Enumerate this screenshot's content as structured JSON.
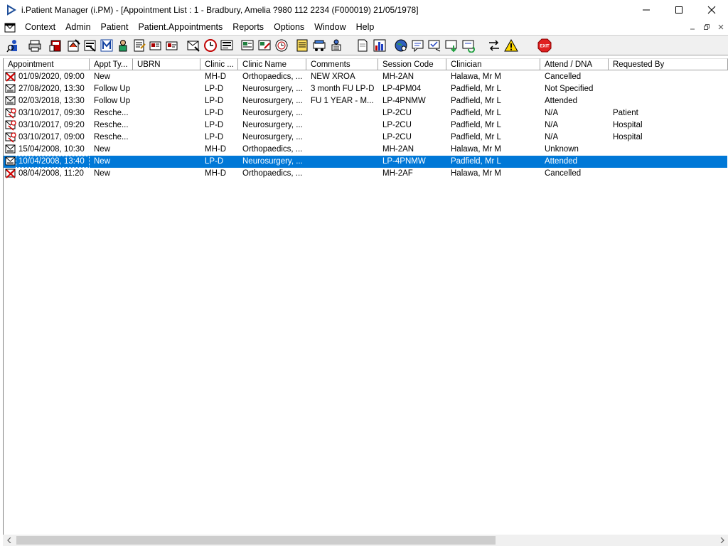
{
  "window": {
    "title": "i.Patient Manager (i.PM) - [Appointment List : 1 - Bradbury, Amelia ?980 112 2234 (F000019) 21/05/1978]",
    "minimize_icon": "minimize-icon",
    "maximize_icon": "maximize-icon",
    "close_icon": "close-icon"
  },
  "menu": {
    "items": [
      "Context",
      "Admin",
      "Patient",
      "Patient.Appointments",
      "Reports",
      "Options",
      "Window",
      "Help"
    ]
  },
  "toolbar": {
    "buttons": [
      "patient-search-icon",
      "print-icon",
      "book-appointment-icon",
      "edit-appointment-icon",
      "appointment-details-icon",
      "letter-m-icon",
      "clinician-icon",
      "notes-icon",
      "referral-icon",
      "referral-card-icon",
      "cancel-mail-icon",
      "clock-icon",
      "screen-list-icon",
      "session-icon",
      "session-edit-icon",
      "session-clock-icon",
      "note-yellow-icon",
      "transport-icon",
      "waiting-list-icon",
      "document-icon",
      "chart-icon",
      "globe-icon",
      "message-icon",
      "message-check-icon",
      "message-down-icon",
      "message-refresh-icon",
      "swap-icon",
      "warning-icon",
      "exit-icon"
    ],
    "exit_label": "EXIT"
  },
  "table": {
    "columns": [
      "Appointment",
      "Appt Ty...",
      "UBRN",
      "Clinic ...",
      "Clinic Name",
      "Comments",
      "Session Code",
      "Clinician",
      "Attend / DNA",
      "Requested By"
    ],
    "rows": [
      {
        "icon": "cancelled-appointment-icon",
        "appointment": "01/09/2020, 09:00",
        "type": "New",
        "ubrn": "",
        "clinic": "MH-D",
        "clinic_name": "Orthopaedics, ...",
        "comments": "NEW XROA",
        "session": "MH-2AN",
        "clinician": "Halawa, Mr M",
        "attend": "Cancelled",
        "requested": ""
      },
      {
        "icon": "appointment-envelope-icon",
        "appointment": "27/08/2020, 13:30",
        "type": "Follow Up",
        "ubrn": "",
        "clinic": "LP-D",
        "clinic_name": "Neurosurgery, ...",
        "comments": "3 month FU LP-D",
        "session": "LP-4PM04",
        "clinician": "Padfield, Mr L",
        "attend": "Not Specified",
        "requested": ""
      },
      {
        "icon": "appointment-envelope-icon",
        "appointment": "02/03/2018, 13:30",
        "type": "Follow Up",
        "ubrn": "",
        "clinic": "LP-D",
        "clinic_name": "Neurosurgery, ...",
        "comments": "FU 1 YEAR - M...",
        "session": "LP-4PNMW",
        "clinician": "Padfield, Mr L",
        "attend": "Attended",
        "requested": ""
      },
      {
        "icon": "rescheduled-appointment-icon",
        "appointment": "03/10/2017, 09:30",
        "type": "Resche...",
        "ubrn": "",
        "clinic": "LP-D",
        "clinic_name": "Neurosurgery, ...",
        "comments": "",
        "session": "LP-2CU",
        "clinician": "Padfield, Mr L",
        "attend": "N/A",
        "requested": "Patient"
      },
      {
        "icon": "rescheduled-appointment-icon",
        "appointment": "03/10/2017, 09:20",
        "type": "Resche...",
        "ubrn": "",
        "clinic": "LP-D",
        "clinic_name": "Neurosurgery, ...",
        "comments": "",
        "session": "LP-2CU",
        "clinician": "Padfield, Mr L",
        "attend": "N/A",
        "requested": "Hospital"
      },
      {
        "icon": "rescheduled-appointment-icon",
        "appointment": "03/10/2017, 09:00",
        "type": "Resche...",
        "ubrn": "",
        "clinic": "LP-D",
        "clinic_name": "Neurosurgery, ...",
        "comments": "",
        "session": "LP-2CU",
        "clinician": "Padfield, Mr L",
        "attend": "N/A",
        "requested": "Hospital"
      },
      {
        "icon": "appointment-envelope-icon",
        "appointment": "15/04/2008, 10:30",
        "type": "New",
        "ubrn": "",
        "clinic": "MH-D",
        "clinic_name": "Orthopaedics, ...",
        "comments": "",
        "session": "MH-2AN",
        "clinician": "Halawa, Mr M",
        "attend": "Unknown",
        "requested": ""
      },
      {
        "icon": "appointment-envelope-icon",
        "appointment": "10/04/2008, 13:40",
        "type": "New",
        "ubrn": "",
        "clinic": "LP-D",
        "clinic_name": "Neurosurgery, ...",
        "comments": "",
        "session": "LP-4PNMW",
        "clinician": "Padfield, Mr L",
        "attend": "Attended",
        "requested": "",
        "selected": true
      },
      {
        "icon": "cancelled-appointment-icon",
        "appointment": "08/04/2008, 11:20",
        "type": "New",
        "ubrn": "",
        "clinic": "MH-D",
        "clinic_name": "Orthopaedics, ...",
        "comments": "",
        "session": "MH-2AF",
        "clinician": "Halawa, Mr M",
        "attend": "Cancelled",
        "requested": ""
      }
    ]
  },
  "colors": {
    "selection": "#0078d7",
    "toolbar_bg": "#f0f0f0",
    "cancel_red": "#d40000",
    "exit_red": "#e02020"
  }
}
